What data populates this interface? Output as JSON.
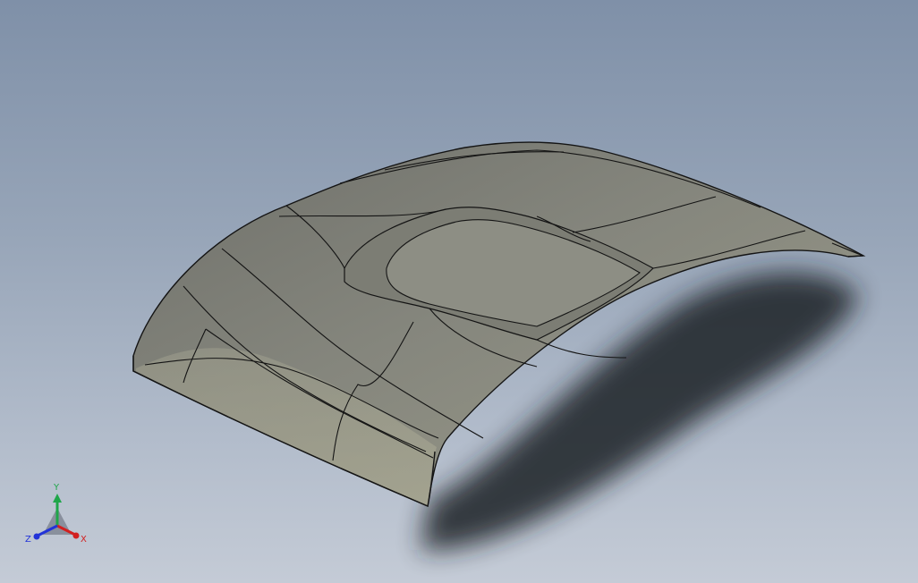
{
  "viewport": {
    "background_top": "#7f90a8",
    "background_bottom": "#c4cbd6",
    "model_color": "#8a8b7f",
    "edge_color": "#141414"
  },
  "triad": {
    "x_label": "X",
    "y_label": "Y",
    "z_label": "Z",
    "x_color": "#d22020",
    "y_color": "#1fa64a",
    "z_color": "#2233d8"
  }
}
